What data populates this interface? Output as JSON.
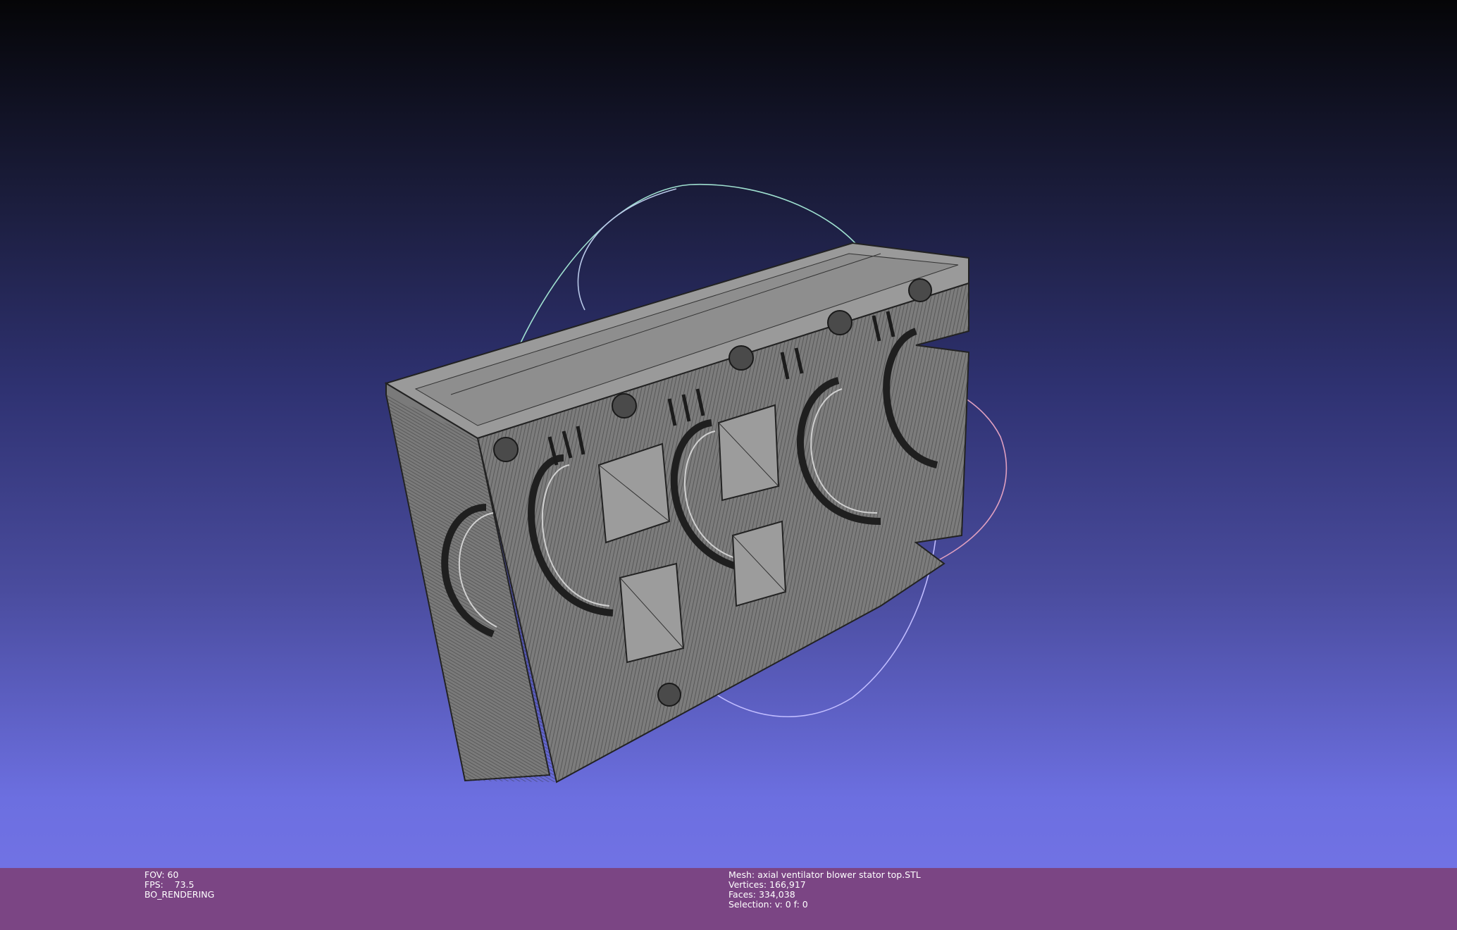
{
  "viewport": {
    "mesh_fill": "#8a8a8a",
    "wire_color": "#2a2a2a",
    "trackball_colors": [
      "#8fe0c8",
      "#e08fb0",
      "#b7b4ff"
    ]
  },
  "info_left": {
    "fov": "FOV: 60",
    "fps": "FPS:    73.5",
    "mode": "BO_RENDERING"
  },
  "info_right": {
    "mesh": "Mesh: axial ventilator blower stator top.STL",
    "vertices": "Vertices: 166,917",
    "faces": "Faces: 334,038",
    "selection": "Selection: v: 0 f: 0"
  }
}
